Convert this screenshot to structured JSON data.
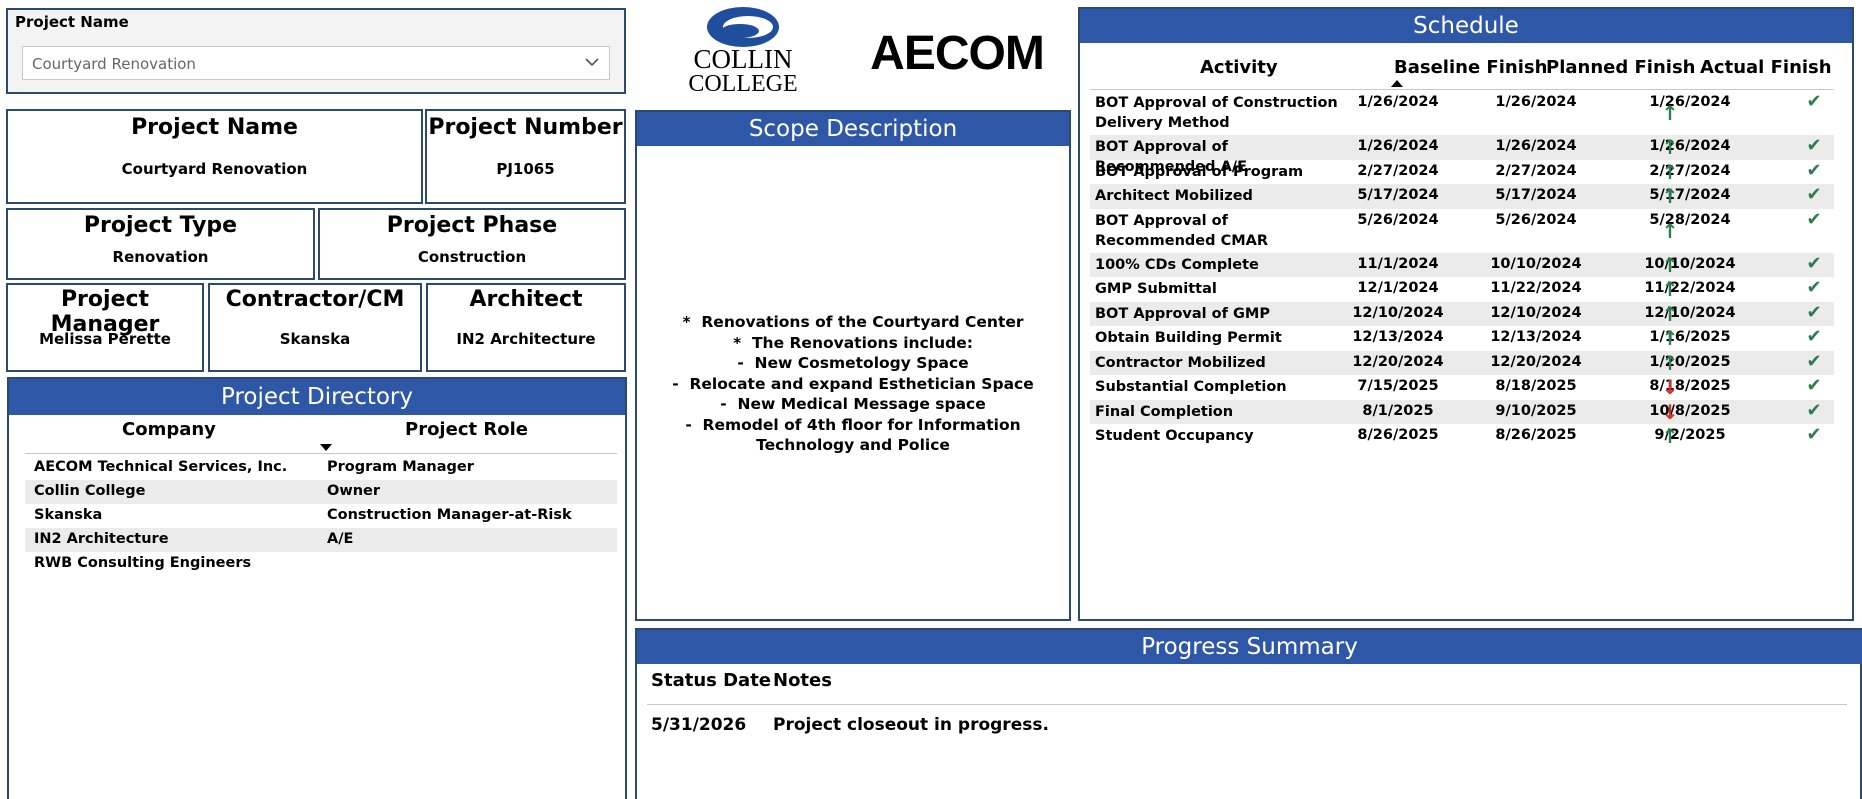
{
  "slicer": {
    "title": "Project Name",
    "value": "Courtyard Renovation"
  },
  "logos": {
    "collin_line1": "COLLIN",
    "collin_line2": "COLLEGE",
    "aecom": "AECOM"
  },
  "cards": {
    "project_name": {
      "title": "Project Name",
      "value": "Courtyard Renovation"
    },
    "project_number": {
      "title": "Project Number",
      "value": "PJ1065"
    },
    "project_type": {
      "title": "Project Type",
      "value": "Renovation"
    },
    "project_phase": {
      "title": "Project Phase",
      "value": "Construction"
    },
    "project_manager": {
      "title": "Project Manager",
      "value": "Melissa Perette"
    },
    "contractor": {
      "title": "Contractor/CM",
      "value": "Skanska"
    },
    "architect": {
      "title": "Architect",
      "value": "IN2 Architecture"
    }
  },
  "directory": {
    "title": "Project Directory",
    "col_company": "Company",
    "col_role": "Project Role",
    "rows": [
      {
        "company": "AECOM Technical Services, Inc.",
        "role": "Program Manager"
      },
      {
        "company": "Collin College",
        "role": "Owner"
      },
      {
        "company": "Skanska",
        "role": "Construction Manager-at-Risk"
      },
      {
        "company": "IN2 Architecture",
        "role": "A/E"
      },
      {
        "company": "RWB Consulting Engineers",
        "role": ""
      }
    ]
  },
  "scope": {
    "title": "Scope Description",
    "text": "*  Renovations of the Courtyard Center\n*  The Renovations include:\n-  New Cosmetology Space\n-  Relocate and expand Esthetician Space\n-  New Medical Message space\n-  Remodel of 4th floor for Information\nTechnology and Police"
  },
  "schedule": {
    "title": "Schedule",
    "col_activity": "Activity",
    "col_baseline": "Baseline Finish",
    "col_planned": "Planned Finish",
    "col_actual": "Actual Finish",
    "status_colors": {
      "up": "#2e7d4f",
      "down": "#d32f2f",
      "check": "#2e7d4f"
    },
    "rows": [
      {
        "activity": "BOT Approval of Construction Delivery Method",
        "baseline": "1/26/2024",
        "planned": "1/26/2024",
        "trend": "up",
        "actual": "1/26/2024"
      },
      {
        "activity": "BOT Approval of Recommended A/E",
        "baseline": "1/26/2024",
        "planned": "1/26/2024",
        "trend": "up",
        "actual": "1/26/2024"
      },
      {
        "activity": "BOT Approval of Program Manager",
        "baseline": "2/27/2024",
        "planned": "2/27/2024",
        "trend": "up",
        "actual": "2/27/2024"
      },
      {
        "activity": "Architect Mobilized",
        "baseline": "5/17/2024",
        "planned": "5/17/2024",
        "trend": "up",
        "actual": "5/17/2024"
      },
      {
        "activity": "BOT Approval of Recommended CMAR",
        "baseline": "5/26/2024",
        "planned": "5/26/2024",
        "trend": "up",
        "actual": "5/28/2024"
      },
      {
        "activity": "100% CDs Complete",
        "baseline": "11/1/2024",
        "planned": "10/10/2024",
        "trend": "up",
        "actual": "10/10/2024"
      },
      {
        "activity": "GMP Submittal",
        "baseline": "12/1/2024",
        "planned": "11/22/2024",
        "trend": "up",
        "actual": "11/22/2024"
      },
      {
        "activity": "BOT Approval of GMP",
        "baseline": "12/10/2024",
        "planned": "12/10/2024",
        "trend": "up",
        "actual": "12/10/2024"
      },
      {
        "activity": "Obtain Building Permit",
        "baseline": "12/13/2024",
        "planned": "12/13/2024",
        "trend": "up",
        "actual": "1/16/2025"
      },
      {
        "activity": "Contractor Mobilized",
        "baseline": "12/20/2024",
        "planned": "12/20/2024",
        "trend": "up",
        "actual": "1/20/2025"
      },
      {
        "activity": "Substantial Completion",
        "baseline": "7/15/2025",
        "planned": "8/18/2025",
        "trend": "down",
        "actual": "8/18/2025"
      },
      {
        "activity": "Final Completion",
        "baseline": "8/1/2025",
        "planned": "9/10/2025",
        "trend": "down",
        "actual": "10/8/2025"
      },
      {
        "activity": "Student Occupancy",
        "baseline": "8/26/2025",
        "planned": "8/26/2025",
        "trend": "up",
        "actual": "9/2/2025"
      }
    ]
  },
  "progress": {
    "title": "Progress Summary",
    "col_date": "Status Date",
    "col_notes": "Notes",
    "rows": [
      {
        "date": "5/31/2026",
        "notes": "Project closeout in progress."
      }
    ]
  },
  "colors": {
    "accent": "#2f57a7",
    "border": "#2c4a6b",
    "row_alt": "#ebebeb",
    "header_line": "#c8c8c8"
  }
}
